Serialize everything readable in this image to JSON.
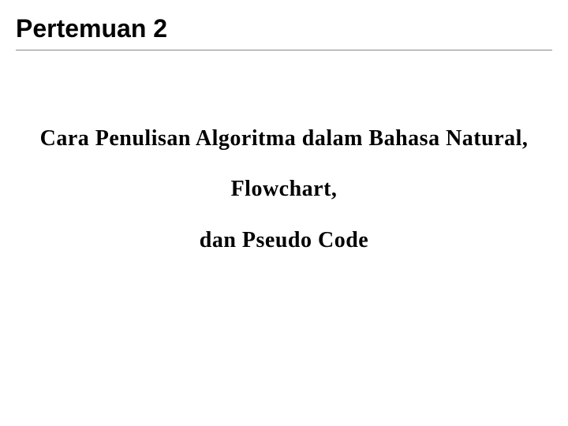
{
  "heading": "Pertemuan 2",
  "subtitle": {
    "line1": "Cara Penulisan Algoritma dalam Bahasa Natural,",
    "line2": "Flowchart,",
    "line3": "dan Pseudo Code"
  }
}
